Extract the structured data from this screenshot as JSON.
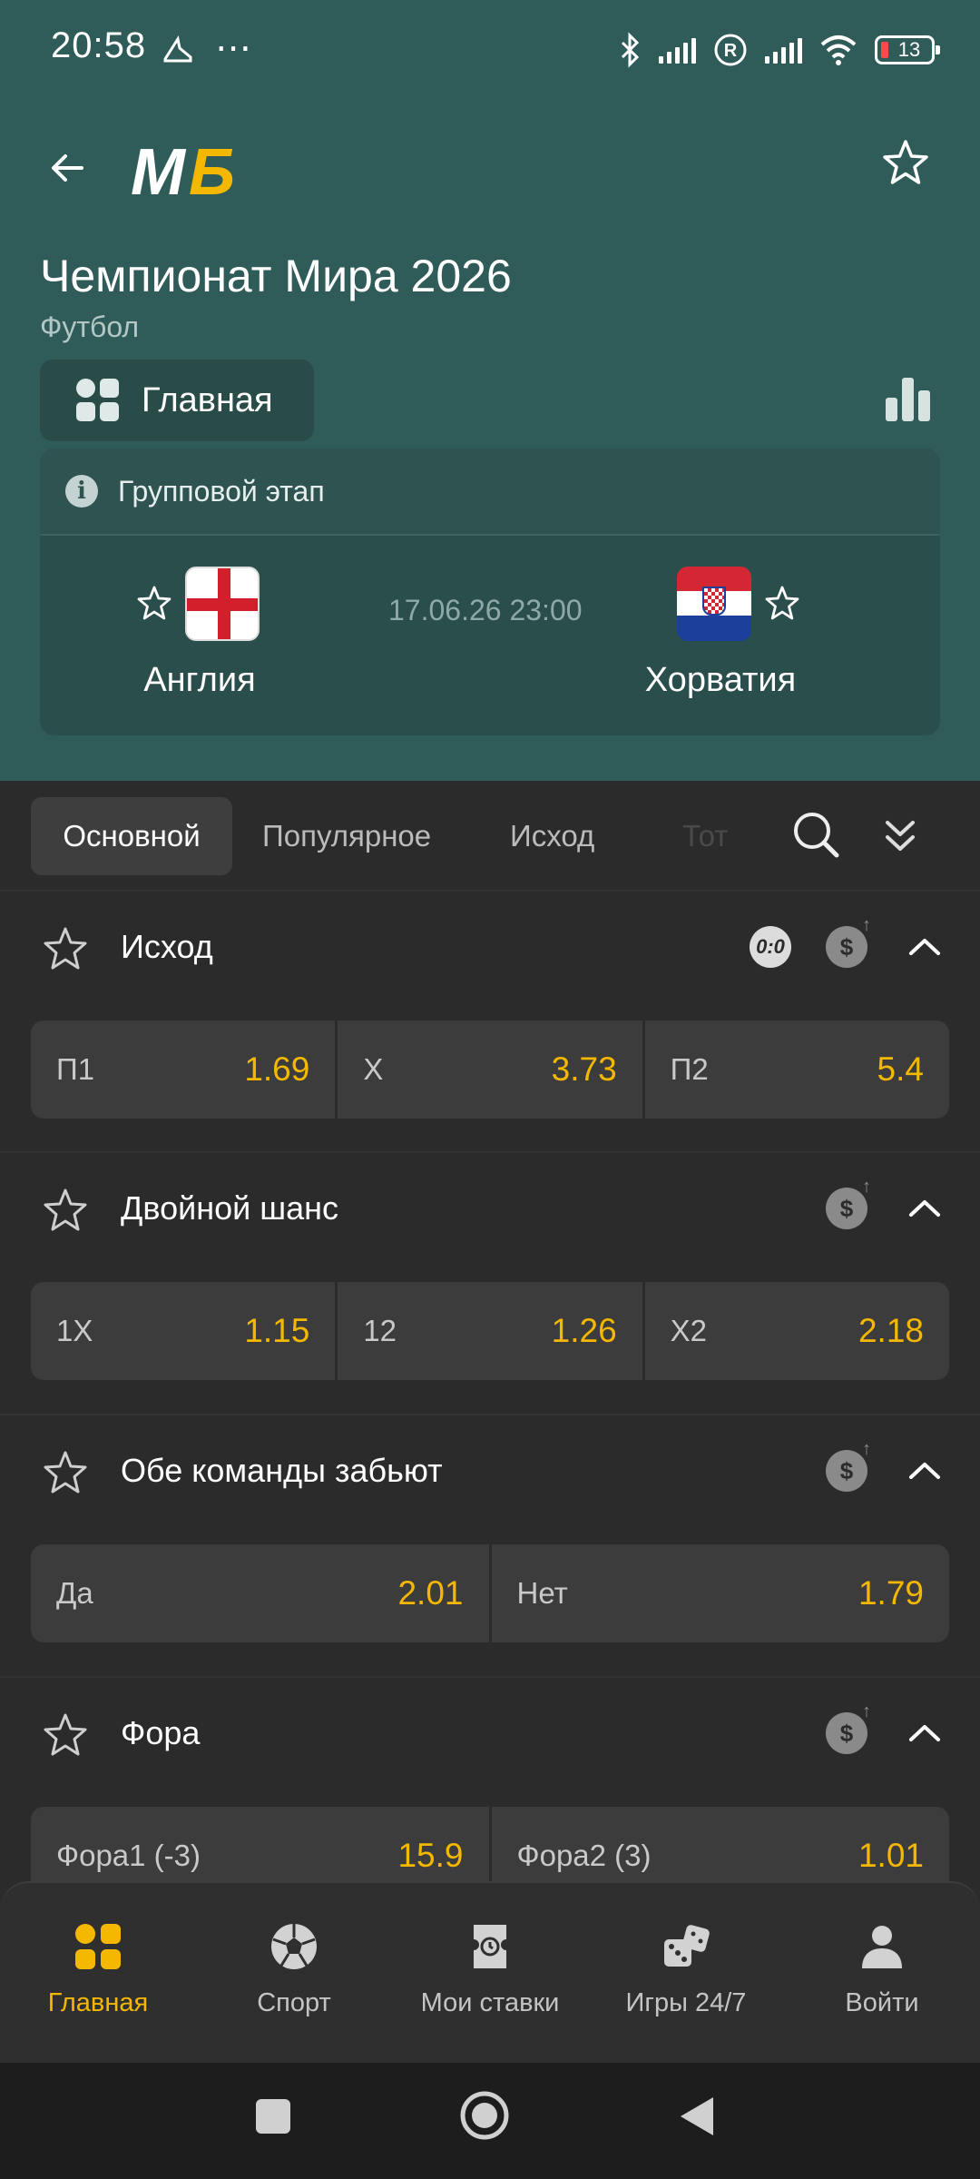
{
  "status_bar": {
    "time": "20:58",
    "extra": "⋯",
    "battery": "13"
  },
  "header": {
    "logo_text": "МБ",
    "event_title": "Чемпионат Мира 2026",
    "sport": "Футбол",
    "main_tab_label": "Главная"
  },
  "match": {
    "stage": "Групповой этап",
    "home_team": "Англия",
    "away_team": "Хорватия",
    "datetime": "17.06.26 23:00"
  },
  "market_tabs": [
    "Основной",
    "Популярное",
    "Исход",
    "Тот"
  ],
  "markets": [
    {
      "title": "Исход",
      "odds": [
        {
          "label": "П1",
          "value": "1.69"
        },
        {
          "label": "Х",
          "value": "3.73"
        },
        {
          "label": "П2",
          "value": "5.4"
        }
      ]
    },
    {
      "title": "Двойной шанс",
      "odds": [
        {
          "label": "1Х",
          "value": "1.15"
        },
        {
          "label": "12",
          "value": "1.26"
        },
        {
          "label": "Х2",
          "value": "2.18"
        }
      ]
    },
    {
      "title": "Обе команды забьют",
      "odds": [
        {
          "label": "Да",
          "value": "2.01"
        },
        {
          "label": "Нет",
          "value": "1.79"
        }
      ]
    },
    {
      "title": "Фора",
      "odds": [
        {
          "label": "Фора1 (-3)",
          "value": "15.9"
        },
        {
          "label": "Фора2 (3)",
          "value": "1.01"
        }
      ]
    }
  ],
  "score_badge": "0:0",
  "bottom_nav": [
    {
      "label": "Главная",
      "icon": "home-grid-icon"
    },
    {
      "label": "Спорт",
      "icon": "soccer-ball-icon"
    },
    {
      "label": "Мои ставки",
      "icon": "ticket-icon"
    },
    {
      "label": "Игры 24/7",
      "icon": "dice-icon"
    },
    {
      "label": "Войти",
      "icon": "user-icon"
    }
  ],
  "colors": {
    "header_bg": "#2f5c59",
    "accent": "#f5b800",
    "page_bg": "#2b2b2b"
  }
}
